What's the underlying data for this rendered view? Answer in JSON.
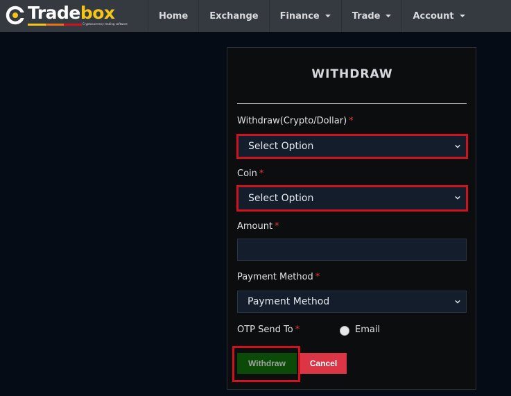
{
  "brand": {
    "name_part1": "Trade",
    "name_part2": "box",
    "tagline": "Cryptocurrency trading software"
  },
  "nav": {
    "home": "Home",
    "exchange": "Exchange",
    "finance": "Finance",
    "trade": "Trade",
    "account": "Account"
  },
  "form": {
    "title": "WITHDRAW",
    "withdraw_type_label": "Withdraw(Crypto/Dollar)",
    "withdraw_type_value": "Select Option",
    "coin_label": "Coin",
    "coin_value": "Select Option",
    "amount_label": "Amount",
    "amount_value": "",
    "payment_method_label": "Payment Method",
    "payment_method_value": "Payment Method",
    "otp_label": "OTP Send To",
    "otp_option": "Email",
    "required_mark": "*",
    "withdraw_button": "Withdraw",
    "cancel_button": "Cancel"
  },
  "colors": {
    "accent_yellow": "#f5c518",
    "highlight_red": "#d0121e",
    "withdraw_green": "#0c4a08",
    "cancel_red": "#dc3545"
  }
}
